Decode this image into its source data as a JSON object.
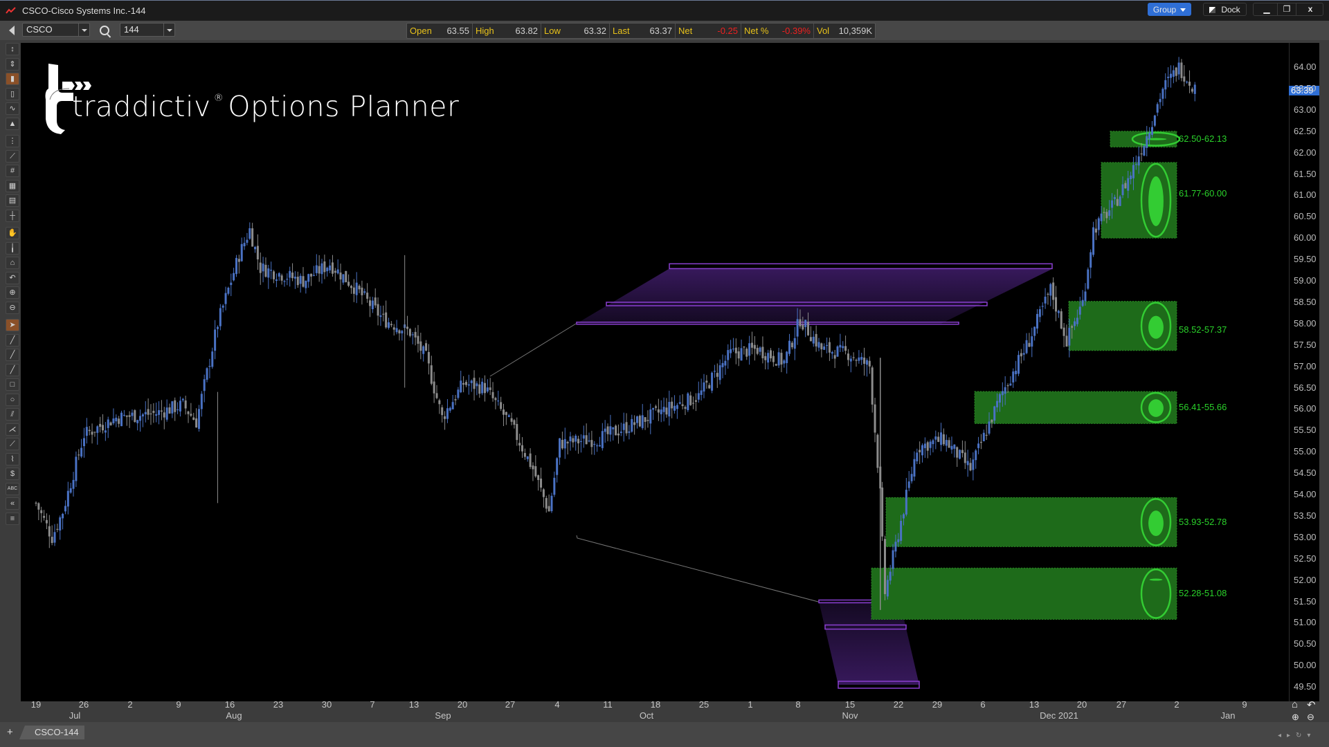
{
  "window": {
    "title": "CSCO-Cisco Systems Inc.-144",
    "buttons": {
      "group": "Group",
      "dock": "Dock",
      "minimize": "▁",
      "restore": "❐",
      "close": "x"
    }
  },
  "toolbar": {
    "symbol": "CSCO",
    "period": "144",
    "quote": [
      {
        "label": "Open",
        "value": "63.55",
        "negative": false
      },
      {
        "label": "High",
        "value": "63.82",
        "negative": false
      },
      {
        "label": "Low",
        "value": "63.32",
        "negative": false
      },
      {
        "label": "Last",
        "value": "63.37",
        "negative": false
      },
      {
        "label": "Net",
        "value": "-0.25",
        "negative": true
      },
      {
        "label": "Net %",
        "value": "-0.39%",
        "negative": true
      },
      {
        "label": "Vol",
        "value": "10,359K",
        "negative": false
      }
    ]
  },
  "left_tools": [
    "bar-chart-icon",
    "hollow-bar-icon",
    "candlestick-icon",
    "ohlc-icon",
    "line-chart-icon",
    "mountain-chart-icon",
    "scale-icon",
    "log-scale-icon",
    "grid-icon",
    "table-icon",
    "data-box-icon",
    "crosshair-icon",
    "hand-icon",
    "cursor-small-icon",
    "home-icon",
    "undo-icon",
    "zoom-in-icon",
    "zoom-out-icon",
    "pointer-icon",
    "line-tool-icon",
    "ray-tool-icon",
    "segment-tool-icon",
    "rectangle-tool-icon",
    "ellipse-tool-icon",
    "channel-tool-icon",
    "fan-tool-icon",
    "fib-tool-icon",
    "polyline-tool-icon",
    "price-tool-icon",
    "text-tool-icon",
    "rewind-icon",
    "menu-icon"
  ],
  "active_tools": [
    "candlestick-icon",
    "pointer-icon"
  ],
  "logo": {
    "brand": "traddictiv",
    "reg": "®",
    "product": "Options Planner"
  },
  "colors": {
    "up_candle": "#4a72c4",
    "down_candle": "#8c8c8c",
    "zone_fill": "#1e6b1a",
    "zone_accent": "#33cc33",
    "purple": "#8a3fd0",
    "accent_blue": "#2f6fd6",
    "quote_label": "#e8c21a",
    "negative": "#ee2020"
  },
  "chart_data": {
    "type": "candlestick",
    "symbol": "CSCO",
    "period": "144",
    "ylim": [
      49.4,
      64.35
    ],
    "price_ticks": [
      "64.00",
      "63.50",
      "63.00",
      "62.50",
      "62.00",
      "61.50",
      "61.00",
      "60.50",
      "60.00",
      "59.50",
      "59.00",
      "58.50",
      "58.00",
      "57.50",
      "57.00",
      "56.50",
      "56.00",
      "55.50",
      "55.00",
      "54.50",
      "54.00",
      "53.50",
      "53.00",
      "52.50",
      "52.00",
      "51.50",
      "51.00",
      "50.50",
      "50.00",
      "49.50"
    ],
    "last_price": "63.39",
    "date_ticks": [
      "19",
      "26",
      "2",
      "9",
      "16",
      "23",
      "30",
      "7",
      "13",
      "20",
      "27",
      "4",
      "11",
      "18",
      "25",
      "1",
      "8",
      "15",
      "22",
      "29",
      "6",
      "13",
      "20",
      "27",
      "2",
      "9"
    ],
    "month_labels": [
      "Jul",
      "Aug",
      "Sep",
      "Oct",
      "Nov",
      "Dec 2021",
      "Jan"
    ],
    "price_path_keypoints": [
      [
        0,
        53.8
      ],
      [
        6,
        53.0
      ],
      [
        10,
        53.6
      ],
      [
        18,
        55.4
      ],
      [
        30,
        55.8
      ],
      [
        45,
        55.9
      ],
      [
        55,
        56.1
      ],
      [
        60,
        55.7
      ],
      [
        68,
        58.0
      ],
      [
        76,
        59.6
      ],
      [
        80,
        60.2
      ],
      [
        84,
        59.3
      ],
      [
        100,
        59.0
      ],
      [
        110,
        59.4
      ],
      [
        120,
        58.8
      ],
      [
        130,
        58.1
      ],
      [
        140,
        57.8
      ],
      [
        146,
        57.2
      ],
      [
        152,
        55.8
      ],
      [
        160,
        56.6
      ],
      [
        168,
        56.5
      ],
      [
        178,
        55.6
      ],
      [
        186,
        54.6
      ],
      [
        192,
        53.6
      ],
      [
        196,
        55.2
      ],
      [
        210,
        55.3
      ],
      [
        222,
        55.6
      ],
      [
        236,
        56.0
      ],
      [
        248,
        56.3
      ],
      [
        260,
        57.3
      ],
      [
        270,
        57.4
      ],
      [
        280,
        57.1
      ],
      [
        286,
        58.1
      ],
      [
        294,
        57.4
      ],
      [
        304,
        57.3
      ],
      [
        312,
        57.0
      ],
      [
        316,
        54.0
      ],
      [
        318,
        51.7
      ],
      [
        322,
        52.8
      ],
      [
        330,
        55.1
      ],
      [
        340,
        55.3
      ],
      [
        350,
        54.6
      ],
      [
        362,
        56.4
      ],
      [
        372,
        57.6
      ],
      [
        380,
        58.8
      ],
      [
        386,
        57.6
      ],
      [
        392,
        58.5
      ],
      [
        396,
        60.2
      ],
      [
        404,
        60.8
      ],
      [
        410,
        61.5
      ],
      [
        416,
        62.4
      ],
      [
        422,
        63.5
      ],
      [
        428,
        64.0
      ],
      [
        434,
        63.5
      ]
    ],
    "volume_profile_zones": [
      {
        "range": "62.50-62.13",
        "high": 62.5,
        "low": 62.13,
        "weight": 0.05
      },
      {
        "range": "61.77-60.00",
        "high": 61.77,
        "low": 60.0,
        "weight": 0.62
      },
      {
        "range": "58.52-57.37",
        "high": 58.52,
        "low": 57.37,
        "weight": 0.45
      },
      {
        "range": "56.41-55.66",
        "high": 56.41,
        "low": 55.66,
        "weight": 0.55
      },
      {
        "range": "53.93-52.78",
        "high": 53.93,
        "low": 52.78,
        "weight": 0.5
      },
      {
        "range": "52.28-51.08",
        "high": 52.28,
        "low": 51.08,
        "weight": 0.03
      }
    ],
    "purple_projections": [
      {
        "name": "upper",
        "levels": [
          59.35,
          58.45,
          58.0
        ]
      },
      {
        "name": "lower",
        "levels": [
          51.5,
          50.9,
          49.55
        ]
      }
    ]
  },
  "bottom": {
    "add_tab": "+",
    "tab": "CSCO-144"
  }
}
